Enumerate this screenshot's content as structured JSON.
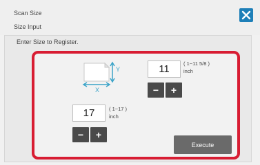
{
  "header": {
    "title": "Scan Size",
    "subtitle": "Size Input",
    "close_icon": "close-icon",
    "close_color": "#1e7fb8"
  },
  "instruction": "Enter Size to Register.",
  "diagram": {
    "icon": "paper-size-icon",
    "y_label": "Y",
    "x_label": "X",
    "arrow_color": "#3aa3c8"
  },
  "y_input": {
    "value": "11",
    "range": "( 1~11 5/8 )",
    "unit": "inch",
    "minus_label": "−",
    "plus_label": "+"
  },
  "x_input": {
    "value": "17",
    "range": "( 1~17 )",
    "unit": "inch",
    "minus_label": "−",
    "plus_label": "+"
  },
  "execute_label": "Execute",
  "highlight_color": "#d81d33"
}
